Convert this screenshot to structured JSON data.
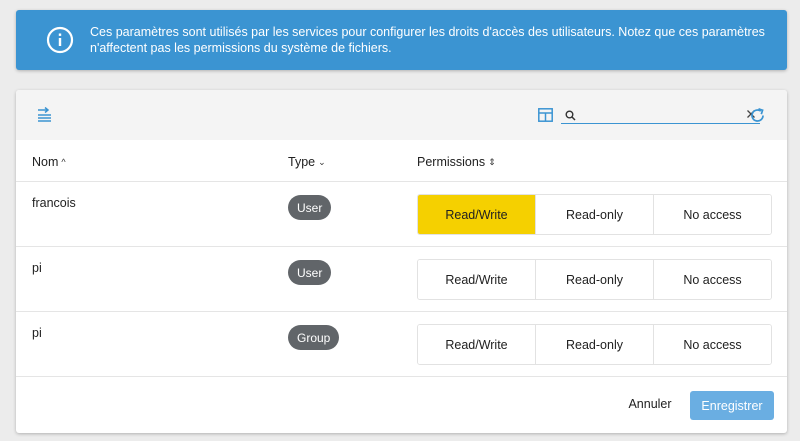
{
  "info_banner": {
    "icon": "info-circle-icon",
    "text": "Ces paramètres sont utilisés par les services pour configurer les droits d'accès des utilisateurs. Notez que ces paramètres n'affectent pas les permissions du système de fichiers."
  },
  "toolbar": {
    "left_icon": "filter-list-icon",
    "columns_icon": "table-columns-icon",
    "search_icon": "search-icon",
    "search_value": "",
    "clear_icon": "close-icon",
    "refresh_icon": "refresh-icon"
  },
  "table": {
    "columns": {
      "name": "Nom",
      "name_sort": "^",
      "type": "Type",
      "type_sort": "⌄",
      "permissions": "Permissions",
      "permissions_sort": "⇕"
    },
    "permission_options": [
      "Read/Write",
      "Read-only",
      "No access"
    ],
    "rows": [
      {
        "name": "francois",
        "type": "User",
        "selected": "Read/Write"
      },
      {
        "name": "pi",
        "type": "User",
        "selected": ""
      },
      {
        "name": "pi",
        "type": "Group",
        "selected": ""
      }
    ]
  },
  "footer": {
    "cancel_label": "Annuler",
    "save_label": "Enregistrer"
  },
  "colors": {
    "accent": "#3b94d2",
    "selected_permission": "#f5d000",
    "badge": "#616569",
    "save_button": "#6aaee2"
  }
}
